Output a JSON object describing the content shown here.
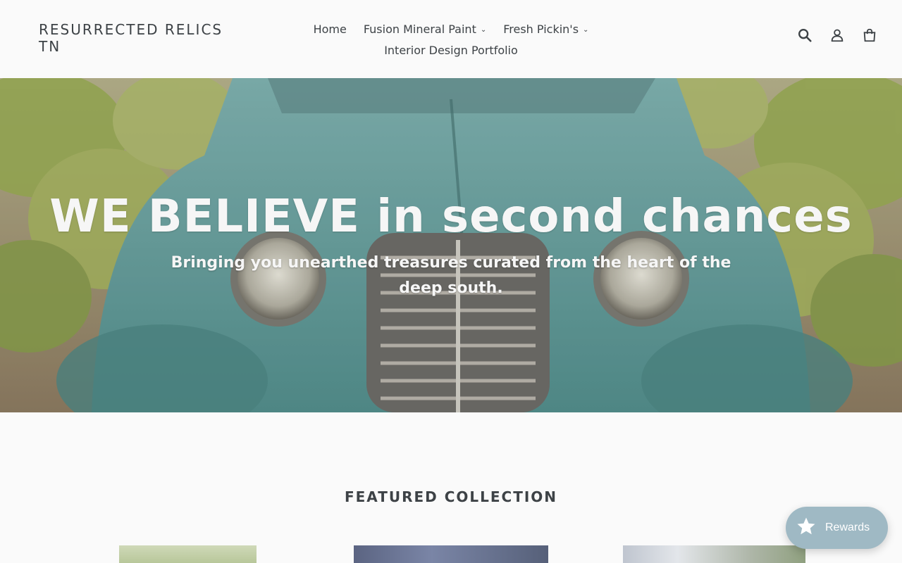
{
  "header": {
    "logo": "RESURRECTED RELICS TN",
    "nav": [
      {
        "label": "Home",
        "has_dropdown": false
      },
      {
        "label": "Fusion Mineral Paint",
        "has_dropdown": true
      },
      {
        "label": "Fresh Pickin's",
        "has_dropdown": true
      },
      {
        "label": "Interior Design Portfolio",
        "has_dropdown": false
      }
    ],
    "icons": [
      "search-icon",
      "account-icon",
      "cart-icon"
    ]
  },
  "hero": {
    "title": "WE BELIEVE in second chances",
    "subtitle": "Bringing you unearthed treasures curated from the heart of the deep south."
  },
  "featured": {
    "heading": "FEATURED COLLECTION"
  },
  "rewards": {
    "label": "Rewards",
    "icon": "star-icon",
    "color": "#9fb9c4"
  }
}
